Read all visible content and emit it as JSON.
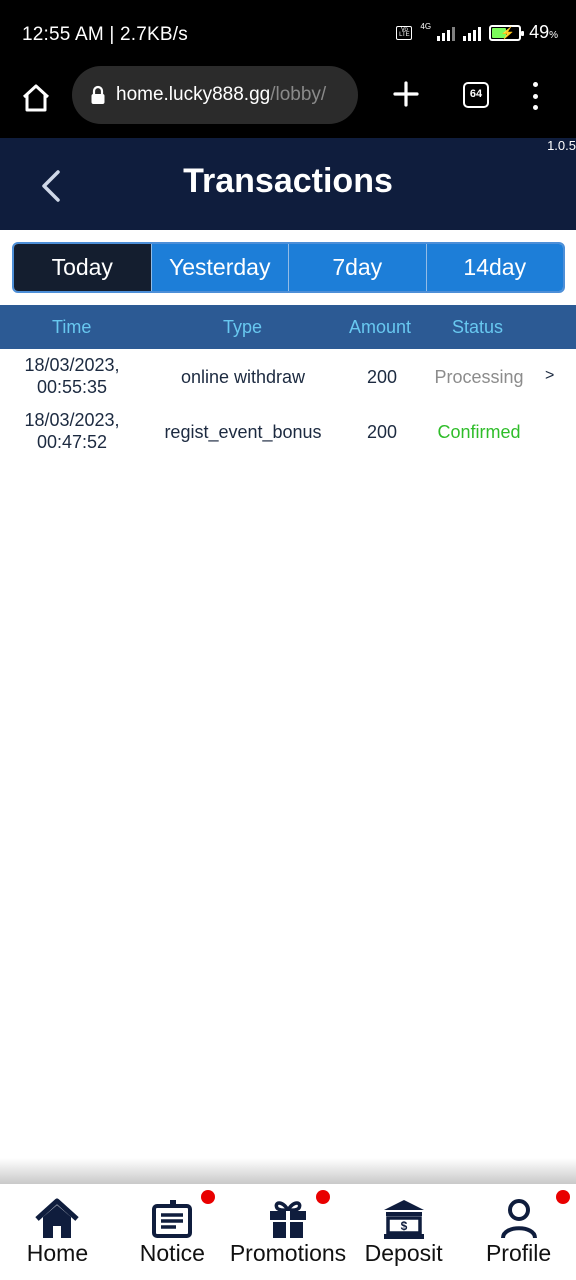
{
  "status_bar": {
    "time": "12:55 AM | 2.7KB/s",
    "network": "4G",
    "volte": "Vo LTE",
    "battery_percent": "49",
    "battery_unit": "%",
    "battery_level": 0.49
  },
  "browser": {
    "url_host": "home.lucky888.gg",
    "url_path": "/lobby/",
    "tab_count": "64"
  },
  "header": {
    "title": "Transactions",
    "version": "1.0.5"
  },
  "filters": {
    "tabs": [
      {
        "label": "Today",
        "active": true
      },
      {
        "label": "Yesterday",
        "active": false
      },
      {
        "label": "7day",
        "active": false
      },
      {
        "label": "14day",
        "active": false
      }
    ]
  },
  "table": {
    "columns": [
      "Time",
      "Type",
      "Amount",
      "Status"
    ],
    "rows": [
      {
        "date": "18/03/2023,",
        "time": "00:55:35",
        "type": "online withdraw",
        "amount": "200",
        "status": "Processing",
        "status_color": "#8c8c8c",
        "arrow": ">"
      },
      {
        "date": "18/03/2023,",
        "time": "00:47:52",
        "type": "regist_event_bonus",
        "amount": "200",
        "status": "Confirmed",
        "status_color": "#2fbd2a",
        "arrow": ""
      }
    ]
  },
  "bottom_nav": {
    "items": [
      {
        "label": "Home",
        "icon": "home-icon",
        "badge": false
      },
      {
        "label": "Notice",
        "icon": "notice-icon",
        "badge": true
      },
      {
        "label": "Promotions",
        "icon": "gift-icon",
        "badge": true
      },
      {
        "label": "Deposit",
        "icon": "bank-icon",
        "badge": false
      },
      {
        "label": "Profile",
        "icon": "user-icon",
        "badge": true
      }
    ]
  },
  "colors": {
    "header_bg": "#0f1d3d",
    "tab_active_bg": "#141e2f",
    "tab_bg": "#1d7ed8",
    "table_header_bg": "#2c5a94",
    "table_header_text": "#68c8f0",
    "badge": "#e90000",
    "nav_icon": "#0f1d3d"
  }
}
